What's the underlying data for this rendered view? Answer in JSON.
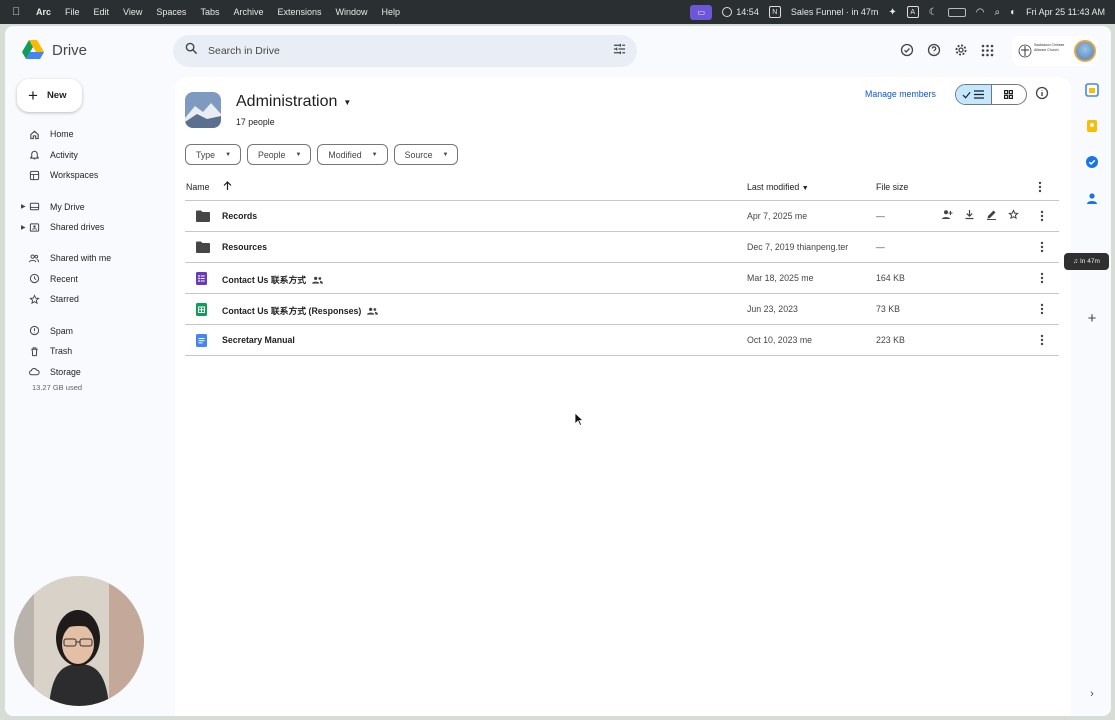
{
  "menubar": {
    "app": "Arc",
    "items": [
      "File",
      "Edit",
      "View",
      "Spaces",
      "Tabs",
      "Archive",
      "Extensions",
      "Window",
      "Help"
    ],
    "timer": "14:54",
    "notion_label": "N",
    "meeting": "Sales Funnel · in 47m",
    "keyboard": "A",
    "datetime": "Fri Apr 25  11:43 AM"
  },
  "drive": {
    "logo_text": "Drive",
    "new_label": "New",
    "search_placeholder": "Search in Drive",
    "nav": [
      {
        "label": "Home",
        "icon": "home-icon"
      },
      {
        "label": "Activity",
        "icon": "bell-icon"
      },
      {
        "label": "Workspaces",
        "icon": "workspaces-icon"
      },
      {
        "label": "My Drive",
        "icon": "drive-icon"
      },
      {
        "label": "Shared drives",
        "icon": "shared-drives-icon"
      },
      {
        "label": "Shared with me",
        "icon": "people-icon"
      },
      {
        "label": "Recent",
        "icon": "clock-icon"
      },
      {
        "label": "Starred",
        "icon": "star-icon"
      },
      {
        "label": "Spam",
        "icon": "spam-icon"
      },
      {
        "label": "Trash",
        "icon": "trash-icon"
      },
      {
        "label": "Storage",
        "icon": "cloud-icon"
      }
    ],
    "storage_used": "13.27 GB used",
    "account_org": "Saskatoon Chinese Alliance Church"
  },
  "shared_drive": {
    "title": "Administration",
    "members": "17 people",
    "manage_label": "Manage members"
  },
  "filters": [
    "Type",
    "People",
    "Modified",
    "Source"
  ],
  "columns": {
    "name": "Name",
    "modified": "Last modified",
    "size": "File size"
  },
  "files": [
    {
      "name": "Records",
      "type": "folder",
      "modified": "Apr 7, 2025 me",
      "size": "—",
      "shared": false
    },
    {
      "name": "Resources",
      "type": "folder",
      "modified": "Dec 7, 2019 thianpeng.ter",
      "size": "—",
      "shared": false
    },
    {
      "name": "Contact Us 联系方式",
      "type": "form",
      "modified": "Mar 18, 2025 me",
      "size": "164 KB",
      "shared": true
    },
    {
      "name": "Contact Us 联系方式 (Responses)",
      "type": "sheet",
      "modified": "Jun 23, 2023",
      "size": "73 KB",
      "shared": true
    },
    {
      "name": "Secretary Manual",
      "type": "doc",
      "modified": "Oct 10, 2023 me",
      "size": "223 KB",
      "shared": false
    }
  ],
  "rail_chip": "In 47m",
  "colors": {
    "accent": "#0b57d0",
    "toggle_on": "#c2e7ff",
    "arc_purple": "#6d56d8",
    "form": "#673ab7",
    "sheet": "#0f9d58",
    "doc": "#4285f4"
  }
}
